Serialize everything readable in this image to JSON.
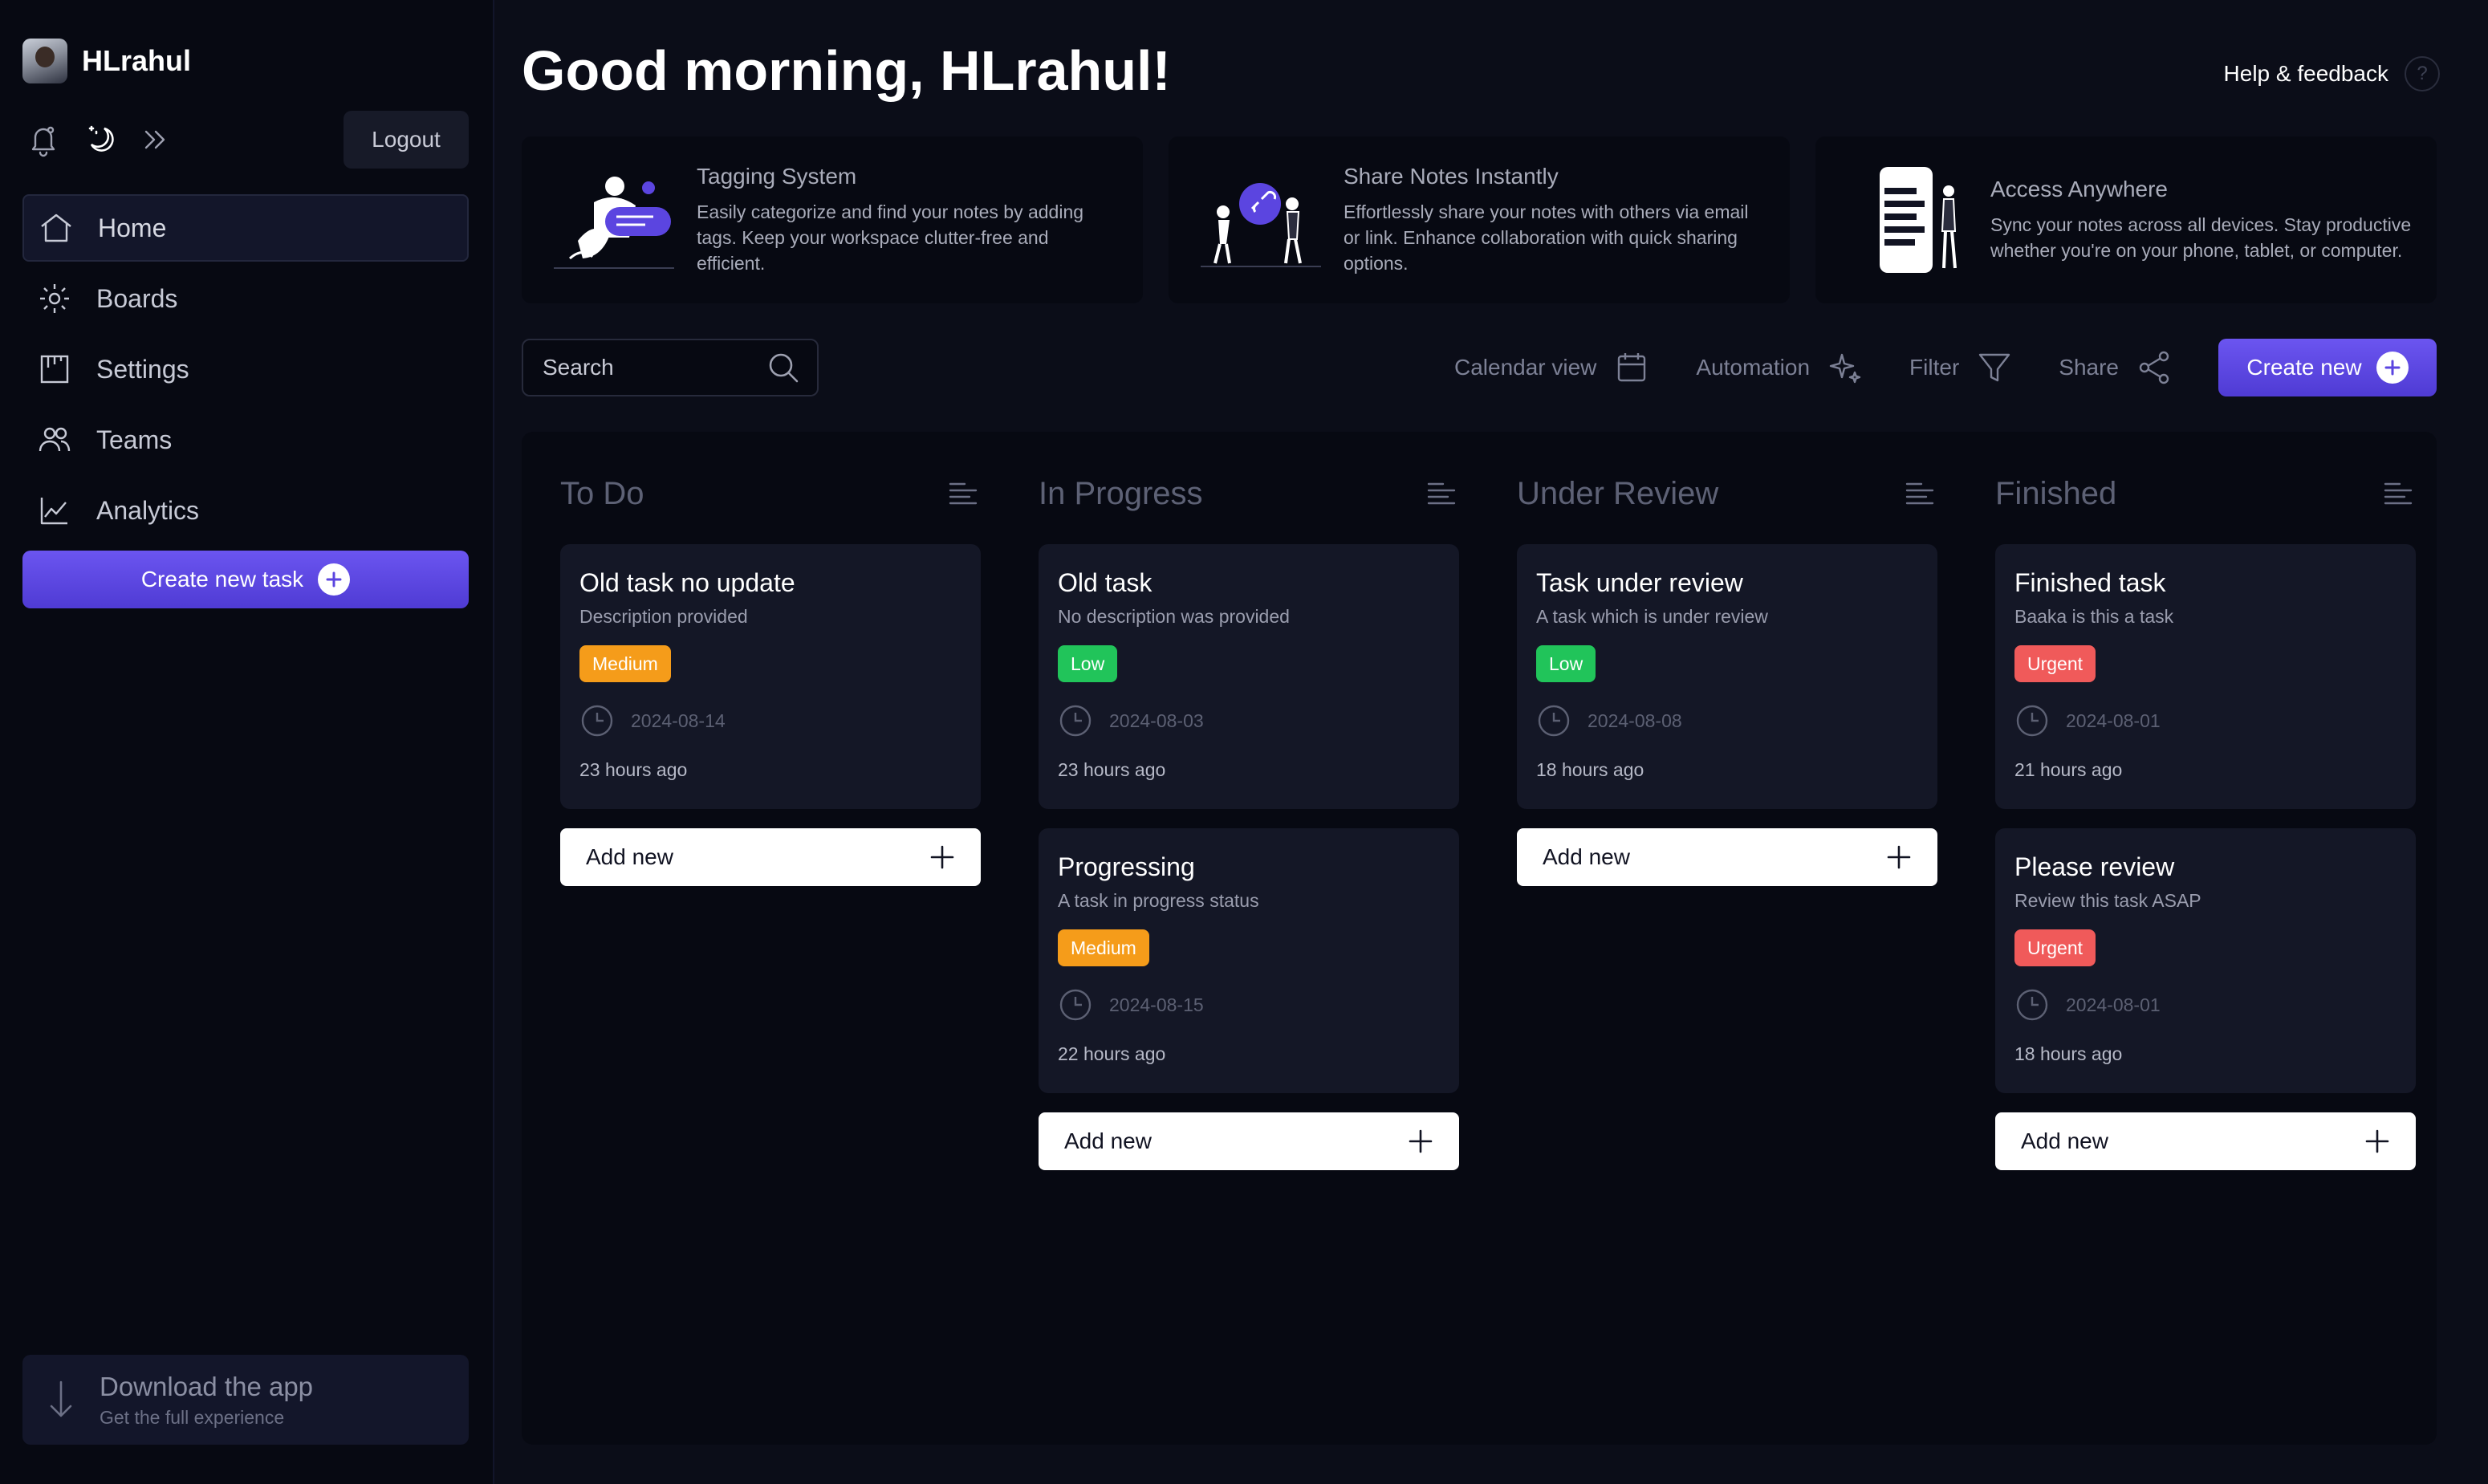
{
  "user": {
    "name": "HLrahul"
  },
  "sidebar": {
    "logout_label": "Logout",
    "nav": [
      {
        "label": "Home",
        "icon": "home-icon",
        "active": true
      },
      {
        "label": "Boards",
        "icon": "gear-icon"
      },
      {
        "label": "Settings",
        "icon": "board-icon"
      },
      {
        "label": "Teams",
        "icon": "users-icon"
      },
      {
        "label": "Analytics",
        "icon": "chart-line-icon"
      }
    ],
    "create_task_label": "Create new task",
    "download": {
      "title": "Download the app",
      "subtitle": "Get the full experience"
    }
  },
  "header": {
    "greeting": "Good morning, HLrahul!",
    "help_label": "Help & feedback",
    "help_icon_text": "?"
  },
  "features": [
    {
      "title": "Tagging System",
      "description": "Easily categorize and find your notes by adding tags. Keep your workspace clutter-free and efficient."
    },
    {
      "title": "Share Notes Instantly",
      "description": "Effortlessly share your notes with others via email or link. Enhance collaboration with quick sharing options."
    },
    {
      "title": "Access Anywhere",
      "description": "Sync your notes across all devices. Stay productive whether you're on your phone, tablet, or computer."
    }
  ],
  "toolbar": {
    "search_placeholder": "Search",
    "calendar_label": "Calendar view",
    "automation_label": "Automation",
    "filter_label": "Filter",
    "share_label": "Share",
    "create_new_label": "Create new"
  },
  "board": {
    "add_new_label": "Add new",
    "columns": [
      {
        "title": "To Do",
        "tasks": [
          {
            "title": "Old task no update",
            "description": "Description provided",
            "priority": "Medium",
            "date": "2024-08-14",
            "ago": "23 hours ago"
          }
        ]
      },
      {
        "title": "In Progress",
        "tasks": [
          {
            "title": "Old task",
            "description": "No description was provided",
            "priority": "Low",
            "date": "2024-08-03",
            "ago": "23 hours ago"
          },
          {
            "title": "Progressing",
            "description": "A task in progress status",
            "priority": "Medium",
            "date": "2024-08-15",
            "ago": "22 hours ago"
          }
        ]
      },
      {
        "title": "Under Review",
        "tasks": [
          {
            "title": "Task under review",
            "description": "A task which is under review",
            "priority": "Low",
            "date": "2024-08-08",
            "ago": "18 hours ago"
          }
        ]
      },
      {
        "title": "Finished",
        "tasks": [
          {
            "title": "Finished task",
            "description": "Baaka is this a task",
            "priority": "Urgent",
            "date": "2024-08-01",
            "ago": "21 hours ago"
          },
          {
            "title": "Please review",
            "description": "Review this task ASAP",
            "priority": "Urgent",
            "date": "2024-08-01",
            "ago": "18 hours ago"
          }
        ]
      }
    ]
  },
  "colors": {
    "accent": "#5b45e0",
    "medium": "#f59c1a",
    "low": "#21c45a",
    "urgent": "#f05a5a",
    "background": "#0b0d18"
  }
}
